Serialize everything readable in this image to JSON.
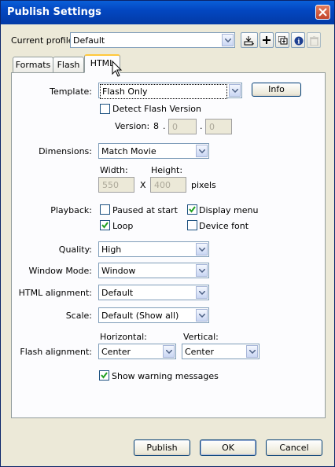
{
  "window": {
    "title": "Publish Settings"
  },
  "profile": {
    "label": "Current profile:",
    "value": "Default"
  },
  "tabs": [
    {
      "label": "Formats"
    },
    {
      "label": "Flash"
    },
    {
      "label": "HTML"
    }
  ],
  "template": {
    "label": "Template:",
    "value": "Flash Only",
    "info_button": "Info"
  },
  "detect": {
    "label": "Detect Flash Version",
    "checked": false,
    "version_label": "Version:",
    "v1": "8",
    "dot": ".",
    "v2": "0",
    "v3": "0"
  },
  "dimensions": {
    "label": "Dimensions:",
    "value": "Match Movie",
    "width_label": "Width:",
    "height_label": "Height:",
    "width": "550",
    "height": "400",
    "x": "X",
    "units": "pixels"
  },
  "playback": {
    "label": "Playback:",
    "paused_at_start": {
      "label": "Paused at start",
      "checked": false
    },
    "display_menu": {
      "label": "Display menu",
      "checked": true
    },
    "loop": {
      "label": "Loop",
      "checked": true
    },
    "device_font": {
      "label": "Device font",
      "checked": false
    }
  },
  "quality": {
    "label": "Quality:",
    "value": "High"
  },
  "window_mode": {
    "label": "Window Mode:",
    "value": "Window"
  },
  "html_alignment": {
    "label": "HTML alignment:",
    "value": "Default"
  },
  "scale": {
    "label": "Scale:",
    "value": "Default (Show all)"
  },
  "flash_alignment": {
    "label": "Flash alignment:",
    "horizontal_label": "Horizontal:",
    "vertical_label": "Vertical:",
    "horizontal": "Center",
    "vertical": "Center"
  },
  "warnings": {
    "label": "Show warning messages",
    "checked": true
  },
  "buttons": {
    "publish": "Publish",
    "ok": "OK",
    "cancel": "Cancel"
  }
}
